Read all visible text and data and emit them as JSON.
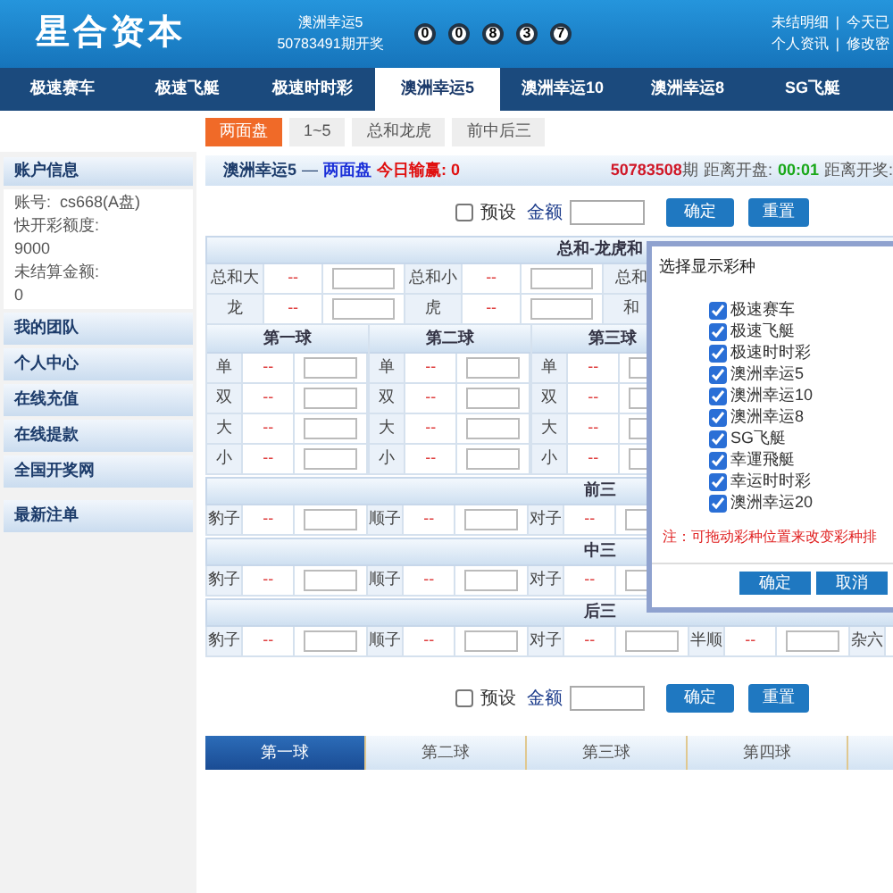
{
  "header": {
    "logo": "星合资本",
    "draw_game": "澳洲幸运5",
    "draw_period": "50783491期开奖",
    "balls": [
      "0",
      "0",
      "8",
      "3",
      "7"
    ],
    "user_links": [
      [
        "未结明细",
        "|",
        "今天已"
      ],
      [
        "个人资讯",
        "|",
        "修改密"
      ]
    ]
  },
  "nav_tabs": [
    {
      "label": "极速赛车",
      "selected": false
    },
    {
      "label": "极速飞艇",
      "selected": false
    },
    {
      "label": "极速时时彩",
      "selected": false
    },
    {
      "label": "澳洲幸运5",
      "selected": true
    },
    {
      "label": "澳洲幸运10",
      "selected": false
    },
    {
      "label": "澳洲幸运8",
      "selected": false
    },
    {
      "label": "SG飞艇",
      "selected": false
    }
  ],
  "sub_tabs": [
    {
      "label": "两面盘",
      "selected": true
    },
    {
      "label": "1~5",
      "selected": false
    },
    {
      "label": "总和龙虎",
      "selected": false
    },
    {
      "label": "前中后三",
      "selected": false
    }
  ],
  "sidebar": {
    "account_title": "账户信息",
    "account_lines": [
      "账号:  cs668(A盘)",
      "快开彩额度:",
      "9000",
      "未结算金额:",
      "0"
    ],
    "menu": [
      "我的团队",
      "个人中心",
      "在线充值",
      "在线提款",
      "全国开奖网",
      "最新注单"
    ]
  },
  "info_bar": {
    "game": "澳洲幸运5",
    "dash": "—",
    "mode": "两面盘",
    "today": "今日输赢: 0",
    "period": "50783508",
    "period_suffix": "期",
    "open_label": "距离开盘:",
    "open_time": "00:01",
    "draw_label": "距离开奖:"
  },
  "bet_bars": [
    {
      "preset_label": "预设",
      "preset_checked": false,
      "amount_label": "金额",
      "confirm": "确定",
      "reset": "重置"
    },
    {
      "preset_label": "预设",
      "preset_checked": false,
      "amount_label": "金额",
      "confirm": "确定",
      "reset": "重置"
    }
  ],
  "sum_section": {
    "title": "总和-龙虎和",
    "rows": [
      [
        {
          "label": "总和大",
          "odds": "--"
        },
        {
          "label": "总和小",
          "odds": "--"
        },
        {
          "label": "总和"
        }
      ],
      [
        {
          "label": "龙",
          "odds": "--"
        },
        {
          "label": "虎",
          "odds": "--"
        },
        {
          "label": "和"
        }
      ]
    ]
  },
  "ball_section": [
    {
      "title": "第一球",
      "items": [
        {
          "label": "单",
          "odds": "--"
        },
        {
          "label": "双",
          "odds": "--"
        },
        {
          "label": "大",
          "odds": "--"
        },
        {
          "label": "小",
          "odds": "--"
        }
      ]
    },
    {
      "title": "第二球",
      "items": [
        {
          "label": "单",
          "odds": "--"
        },
        {
          "label": "双",
          "odds": "--"
        },
        {
          "label": "大",
          "odds": "--"
        },
        {
          "label": "小",
          "odds": "--"
        }
      ]
    },
    {
      "title": "第三球",
      "items": [
        {
          "label": "单",
          "odds": "--"
        },
        {
          "label": "双",
          "odds": "--"
        },
        {
          "label": "大",
          "odds": "--"
        },
        {
          "label": "小",
          "odds": "--"
        }
      ]
    }
  ],
  "triple_sections": [
    {
      "title": "前三",
      "items": [
        {
          "label": "豹子",
          "odds": "--"
        },
        {
          "label": "顺子",
          "odds": "--"
        },
        {
          "label": "对子",
          "odds": "--"
        }
      ]
    },
    {
      "title": "中三",
      "items": [
        {
          "label": "豹子",
          "odds": "--"
        },
        {
          "label": "顺子",
          "odds": "--"
        },
        {
          "label": "对子",
          "odds": "--"
        }
      ]
    },
    {
      "title": "后三",
      "items": [
        {
          "label": "豹子",
          "odds": "--"
        },
        {
          "label": "顺子",
          "odds": "--"
        },
        {
          "label": "对子",
          "odds": "--"
        },
        {
          "label": "半顺",
          "odds": "--"
        },
        {
          "label": "杂六"
        }
      ]
    }
  ],
  "bottom_tabs": [
    {
      "label": "第一球",
      "selected": true
    },
    {
      "label": "第二球",
      "selected": false
    },
    {
      "label": "第三球",
      "selected": false
    },
    {
      "label": "第四球",
      "selected": false
    }
  ],
  "modal": {
    "title": "选择显示彩种",
    "options": [
      {
        "label": "极速赛车",
        "checked": true
      },
      {
        "label": "极速飞艇",
        "checked": true
      },
      {
        "label": "极速时时彩",
        "checked": true
      },
      {
        "label": "澳洲幸运5",
        "checked": true
      },
      {
        "label": "澳洲幸运10",
        "checked": true
      },
      {
        "label": "澳洲幸运8",
        "checked": true
      },
      {
        "label": "SG飞艇",
        "checked": true
      },
      {
        "label": "幸運飛艇",
        "checked": true
      },
      {
        "label": "幸运时时彩",
        "checked": true
      },
      {
        "label": "澳洲幸运20",
        "checked": true
      }
    ],
    "note": "注：可拖动彩种位置来改变彩种排",
    "confirm": "确定",
    "cancel": "取消"
  }
}
